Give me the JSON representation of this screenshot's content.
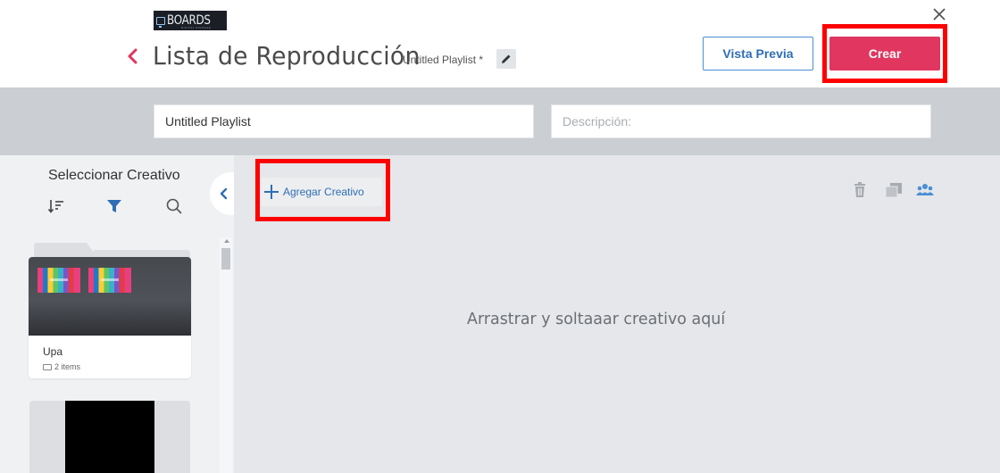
{
  "header": {
    "logo_text": "BOARDS",
    "logo_subtext": "DIGITAL SIGNAGE",
    "title": "Lista de Reproducción",
    "playlist_name_label": "Untitled Playlist *",
    "preview_button": "Vista Previa",
    "create_button": "Crear"
  },
  "form": {
    "name_value": "Untitled Playlist",
    "description_placeholder": "Descripción:"
  },
  "sidebar": {
    "title": "Seleccionar Creativo",
    "folder": {
      "name": "Upa",
      "count": "2 items"
    }
  },
  "main": {
    "add_button": "Agregar Creativo",
    "drop_hint": "Arrastrar y soltaaar creativo aquí"
  },
  "colors": {
    "accent_pink": "#e0365f",
    "accent_blue": "#2f6eb5",
    "highlight_red": "#ff0000",
    "band_gray": "#cbcfd4",
    "main_bg": "#e5e7ea"
  },
  "icons": [
    "back-chevron-icon",
    "edit-pencil-icon",
    "close-icon",
    "sort-icon",
    "filter-icon",
    "search-icon",
    "collapse-chevron-icon",
    "plus-icon",
    "trash-icon",
    "copy-icon",
    "users-icon",
    "folder-icon"
  ]
}
